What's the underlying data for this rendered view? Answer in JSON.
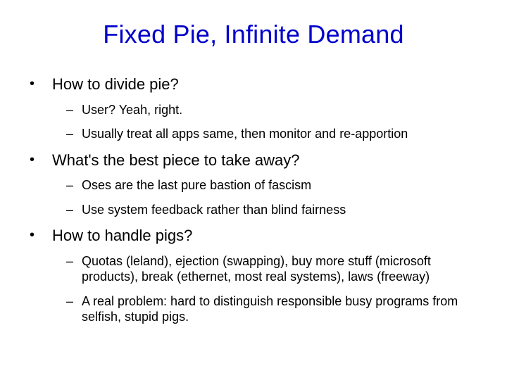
{
  "title": "Fixed Pie, Infinite Demand",
  "bullets": [
    {
      "text": "How to divide pie?",
      "sub": [
        "User?  Yeah, right.",
        "Usually treat all apps same, then monitor and re-apportion"
      ]
    },
    {
      "text": "What's the best piece to take away?",
      "sub": [
        "Oses are the last pure bastion of fascism",
        "Use system feedback rather than blind fairness"
      ]
    },
    {
      "text": "How to handle pigs?",
      "sub": [
        "Quotas (leland), ejection (swapping), buy more stuff (microsoft products), break (ethernet, most real systems), laws (freeway)",
        "A real problem: hard to distinguish responsible busy programs from selfish, stupid pigs."
      ]
    }
  ]
}
